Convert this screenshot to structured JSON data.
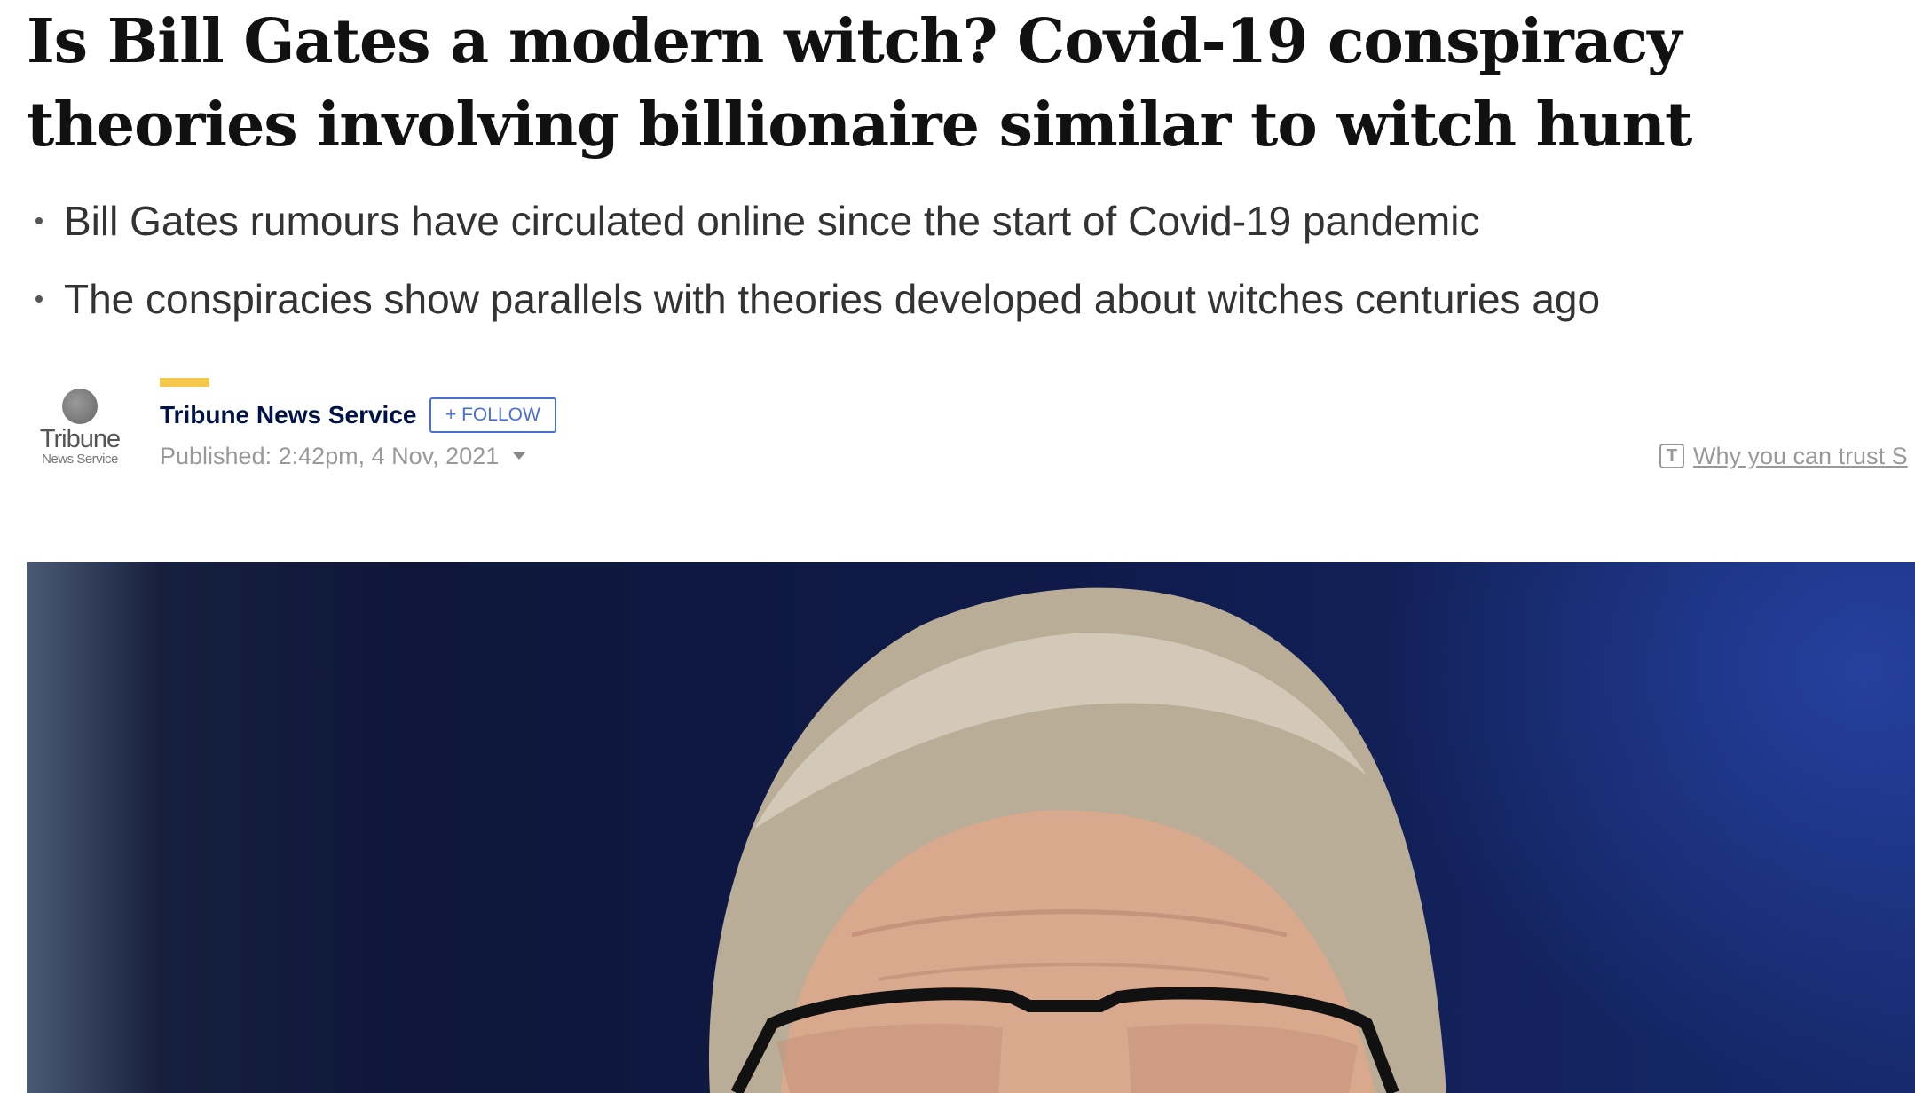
{
  "article": {
    "headline": "Is Bill Gates a modern witch? Covid-19 conspiracy theories involving billionaire similar to witch hunt",
    "bullets": [
      "Bill Gates rumours have circulated online since the start of Covid-19 pandemic",
      "The conspiracies show parallels with theories developed about witches centuries ago"
    ]
  },
  "author": {
    "logo_line1": "Tribune",
    "logo_line2": "News Service",
    "name": "Tribune News Service",
    "follow_label": "+ FOLLOW",
    "published": "Published: 2:42pm, 4 Nov, 2021"
  },
  "trust": {
    "icon_letter": "T",
    "label": "Why you can trust S"
  },
  "hero_image": {
    "icon": "photo"
  },
  "colors": {
    "accent": "#f5c84c",
    "author_name": "#001246",
    "follow": "#4a6fd4"
  }
}
